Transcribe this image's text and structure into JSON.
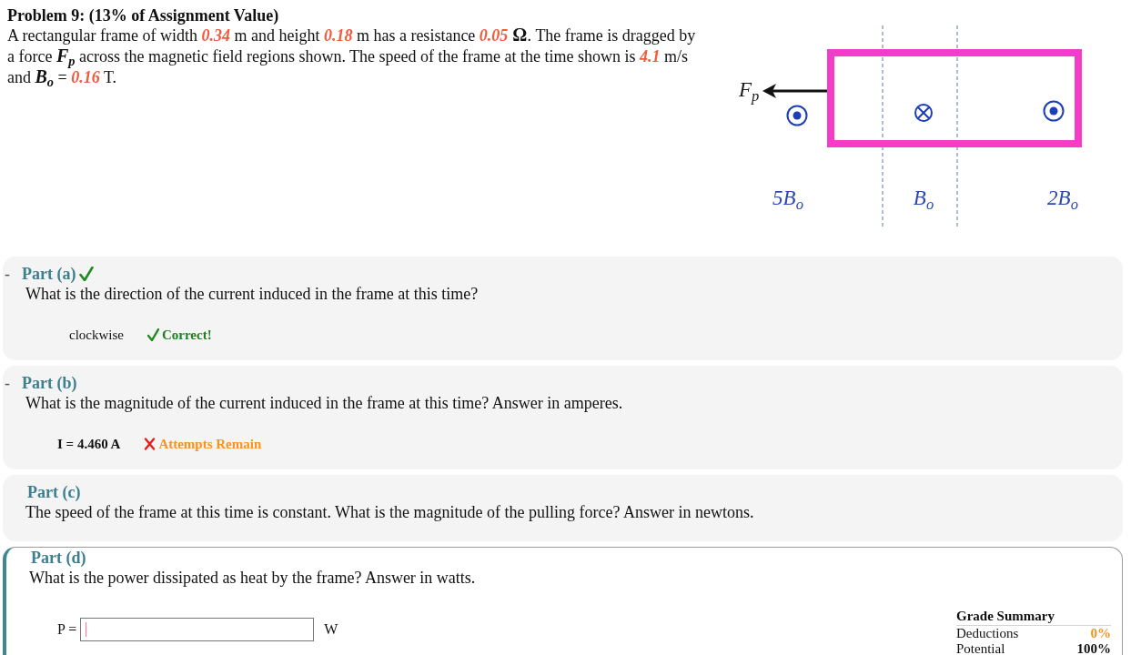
{
  "problem": {
    "title": "Problem 9: (13% of Assignment Value)",
    "statement": [
      {
        "kind": "text",
        "text": "A rectangular frame of width "
      },
      {
        "kind": "value",
        "text": "0.34"
      },
      {
        "kind": "text",
        "text": " m and height "
      },
      {
        "kind": "value",
        "text": "0.18"
      },
      {
        "kind": "text",
        "text": " m has a resistance "
      },
      {
        "kind": "value",
        "text": "0.05"
      },
      {
        "kind": "symbol",
        "text": " Ω"
      },
      {
        "kind": "text",
        "text": ". The frame is dragged by a force "
      },
      {
        "kind": "math",
        "text": "F$_{p}$"
      },
      {
        "kind": "text",
        "text": " across the magnetic field regions shown. The speed of the frame at the time shown is "
      },
      {
        "kind": "value",
        "text": "4.1"
      },
      {
        "kind": "text",
        "text": " m/s and "
      },
      {
        "kind": "math",
        "text": "B$_{o}$"
      },
      {
        "kind": "text",
        "text": " = "
      },
      {
        "kind": "value",
        "text": "0.16"
      },
      {
        "kind": "text",
        "text": " T."
      }
    ]
  },
  "diagram": {
    "force_label": "F$_{p}$",
    "regions": [
      {
        "label": "5B$_{o}$",
        "kind": "out"
      },
      {
        "label": "B$_{o}$",
        "kind": "in"
      },
      {
        "label": "2B$_{o}$",
        "kind": "out"
      }
    ]
  },
  "parts": [
    {
      "title": "Part (a)",
      "toggle": "-",
      "solved": true,
      "active": false,
      "question": "What is the direction of the current induced in the frame at this time?",
      "answer": {
        "kind": "choice",
        "value": "clockwise",
        "feedback": {
          "kind": "correct",
          "text": "Correct!"
        }
      }
    },
    {
      "title": "Part (b)",
      "toggle": "-",
      "solved": false,
      "active": false,
      "question": "What is the magnitude of the current induced in the frame at this time? Answer in amperes.",
      "answer": {
        "kind": "numeric",
        "value": "I = 4.460 A",
        "feedback": {
          "kind": "retry",
          "text": "Attempts Remain"
        }
      }
    },
    {
      "title": "Part (c)",
      "solved": false,
      "active": false,
      "question": "The speed of the frame at this time is constant. What is the magnitude of the pulling force? Answer in newtons."
    },
    {
      "title": "Part (d)",
      "solved": false,
      "active": true,
      "question": "What is the power dissipated as heat by the frame? Answer in watts.",
      "answer": {
        "kind": "input",
        "label": "P =",
        "unit": "W",
        "focused": true
      },
      "grade_summary": {
        "title": "Grade Summary",
        "rows": [
          {
            "kind": "deduction",
            "label": "Deductions",
            "value": "0%"
          },
          {
            "kind": "potential",
            "label": "Potential",
            "value": "100%"
          }
        ]
      }
    }
  ]
}
